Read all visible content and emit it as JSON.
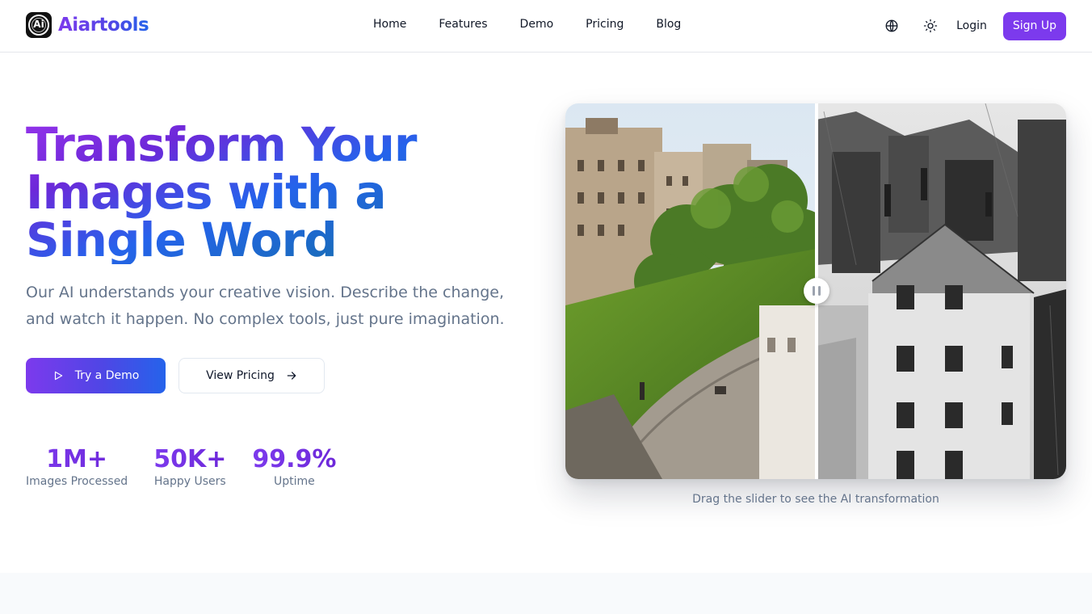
{
  "brand": {
    "name": "Aiartools",
    "logo_text": "Ai"
  },
  "nav": {
    "items": [
      "Home",
      "Features",
      "Demo",
      "Pricing",
      "Blog"
    ]
  },
  "header": {
    "login": "Login",
    "signup": "Sign Up",
    "language_icon": "globe-icon",
    "theme_icon": "sun-icon"
  },
  "hero": {
    "title": "Transform Your Images with a Single Word",
    "subtitle": "Our AI understands your creative vision. Describe the change, and watch it happen. No complex tools, just pure imagination.",
    "primary_button": "Try a Demo",
    "secondary_button": "View Pricing"
  },
  "stats": [
    {
      "value": "1M+",
      "label": "Images Processed"
    },
    {
      "value": "50K+",
      "label": "Happy Users"
    },
    {
      "value": "99.9%",
      "label": "Uptime"
    }
  ],
  "compare": {
    "caption": "Drag the slider to see the AI transformation",
    "slider_position": 0.5,
    "before_label": "color street photo",
    "after_label": "black and white photo"
  },
  "colors": {
    "accent": "#7c3aed",
    "accent2": "#2563eb",
    "muted": "#64748b"
  }
}
